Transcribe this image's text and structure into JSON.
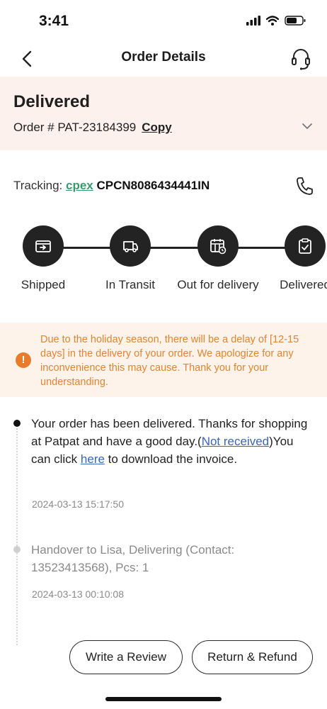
{
  "status_bar": {
    "time": "3:41"
  },
  "nav": {
    "title": "Order Details",
    "back_icon": "chevron-left-icon",
    "support_icon": "headset-icon"
  },
  "order": {
    "status": "Delivered",
    "order_label": "Order # PAT-23184399",
    "copy_label": "Copy"
  },
  "tracking": {
    "label": "Tracking:",
    "carrier": "cpex",
    "number": "CPCN8086434441IN"
  },
  "progress": {
    "steps": [
      {
        "label": "Shipped",
        "icon": "package-transfer-icon"
      },
      {
        "label": "In Transit",
        "icon": "truck-icon"
      },
      {
        "label": "Out for delivery",
        "icon": "calendar-clock-icon"
      },
      {
        "label": "Delivered",
        "icon": "clipboard-check-icon"
      }
    ]
  },
  "notice": {
    "icon": "exclamation-icon",
    "text": "Due to the holiday season, there will be a delay of [12-15 days] in the delivery of your order. We apologize for any inconvenience this may cause. Thank you for your understanding.",
    "color": "#e0852f"
  },
  "timeline": [
    {
      "text_before": "Your order has been delivered. Thanks for shopping at Patpat and have a good day.(",
      "link1": "Not received",
      "text_middle": ")You can click ",
      "link2": "here",
      "text_after": " to download the invoice.",
      "time": "2024-03-13 15:17:50"
    },
    {
      "text": "Handover to Lisa, Delivering (Contact: 13523413568), Pcs: 1",
      "time": "2024-03-13 00:10:08"
    }
  ],
  "actions": {
    "review_label": "Write a Review",
    "refund_label": "Return & Refund"
  },
  "colors": {
    "panel_bg": "#fcf1ec",
    "notice_bg": "#fdf3ea",
    "carrier": "#3a9a6d",
    "link": "#3b66b4",
    "step_circle": "#232323"
  }
}
